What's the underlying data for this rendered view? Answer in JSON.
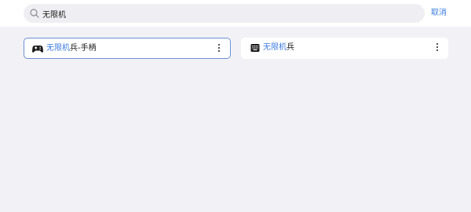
{
  "search": {
    "value": "无限机",
    "placeholder": ""
  },
  "cancel_label": "取消",
  "results": [
    {
      "highlight": "无限机",
      "rest": "兵-手柄",
      "icon": "gamepad-icon"
    },
    {
      "highlight": "无限机",
      "rest": "兵",
      "icon": "keyboard-icon"
    }
  ],
  "colors": {
    "accent": "#3c7ce0",
    "background": "#f2f2f6",
    "card": "#ffffff",
    "selected_border": "#6b8fd6"
  }
}
